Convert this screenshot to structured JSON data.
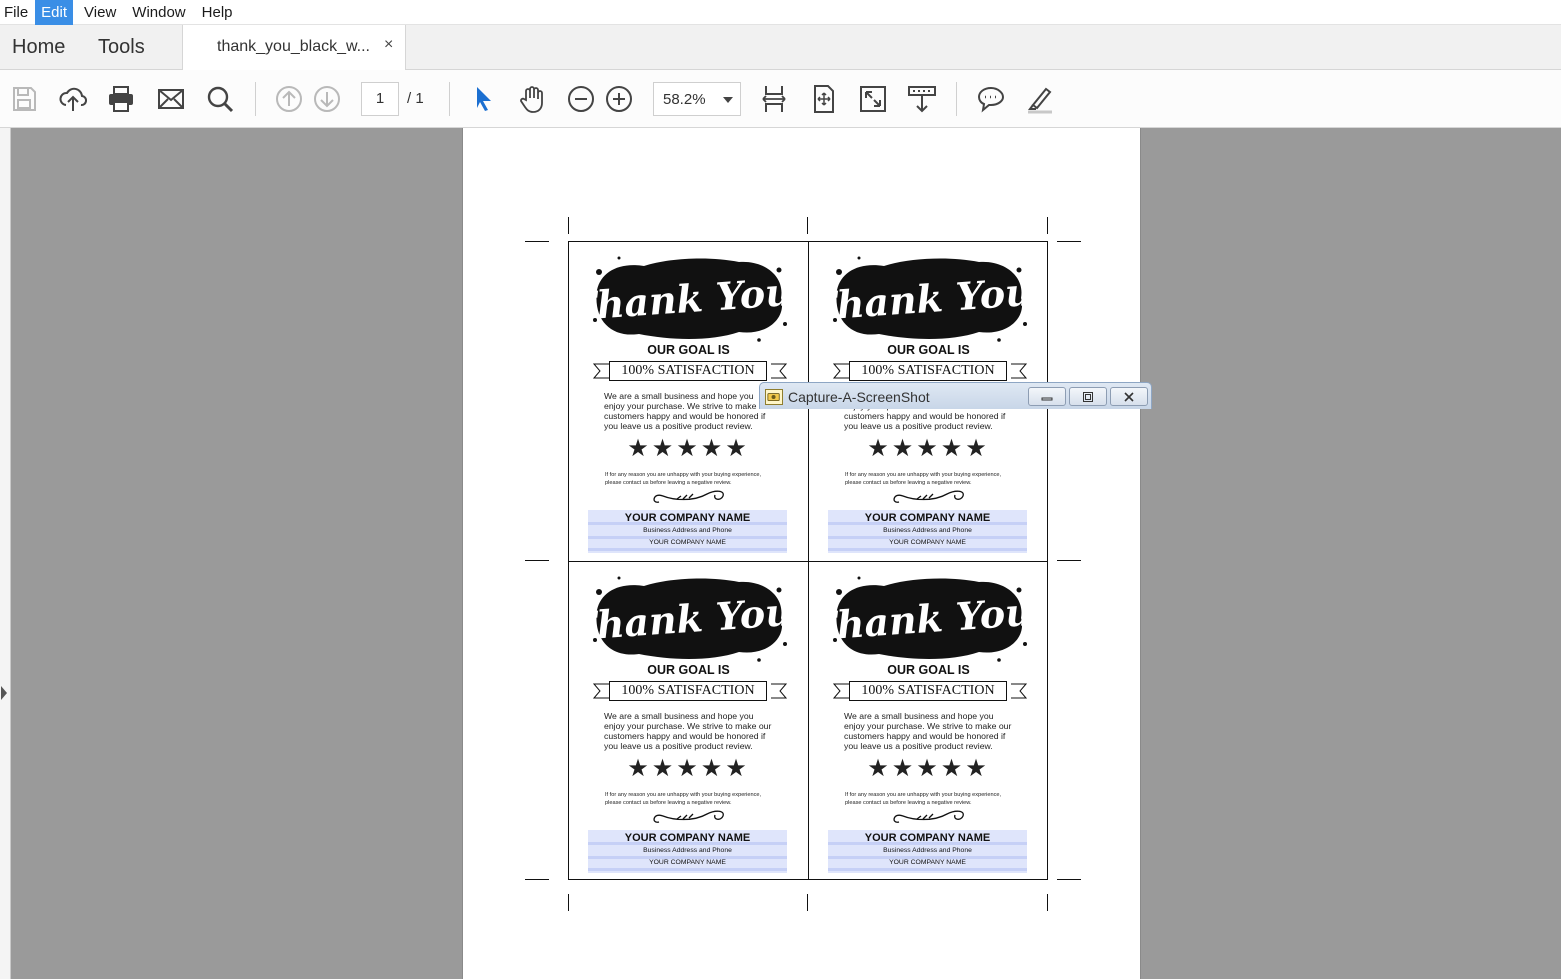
{
  "menu": {
    "items": [
      "File",
      "Edit",
      "View",
      "Window",
      "Help"
    ],
    "active": "Edit"
  },
  "tabs": {
    "home": "Home",
    "tools": "Tools",
    "document": "thank_you_black_w...",
    "close": "×"
  },
  "toolbar": {
    "page_current": "1",
    "page_total": "/ 1",
    "zoom": "58.2%",
    "icons": [
      "save-icon",
      "upload-icon",
      "print-icon",
      "mail-icon",
      "search-icon",
      "prev-page-icon",
      "next-page-icon",
      "select-arrow-icon",
      "hand-icon",
      "zoom-out-icon",
      "zoom-in-icon",
      "fit-width-icon",
      "fit-page-icon",
      "full-screen-icon",
      "scroll-mode-icon",
      "comment-icon",
      "highlight-icon"
    ],
    "accent": "#1b6fd1"
  },
  "card": {
    "goal": "OUR GOAL IS",
    "satisfaction": "100% SATISFACTION",
    "blurb_l1": "We are a small business and hope you",
    "blurb_l2": "enjoy your purchase. We strive to make our",
    "blurb_l3": "customers happy and would be honored if",
    "blurb_l4": "you leave us a positive product review.",
    "stars": "★★★★★",
    "note_l1": "If for any reason you are unhappy with your buying experience,",
    "note_l2": "please contact us before leaving a negative review.",
    "company_name": "YOUR COMPANY NAME",
    "company_addr": "Business Address and Phone",
    "company_sub": "YOUR COMPANY NAME",
    "thank_you": "Thank You!",
    "stripe_color": "#dfe5fb"
  },
  "capture_window": {
    "title": "Capture-A-ScreenShot",
    "icon": "camera-icon"
  }
}
